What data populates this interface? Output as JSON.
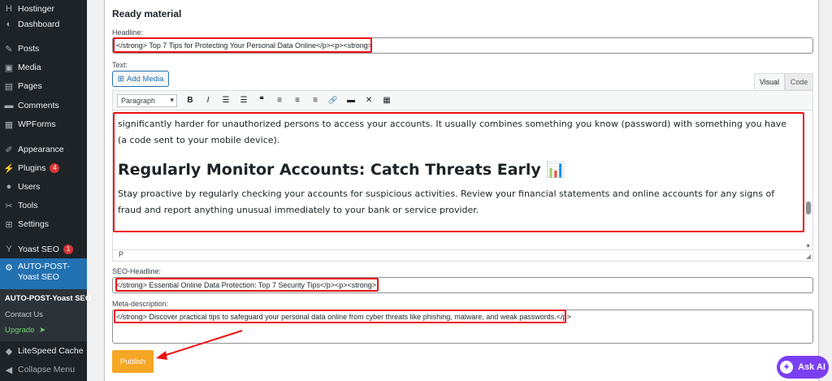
{
  "sidebar": {
    "items": [
      {
        "label": "Hostinger",
        "icon": "hostinger-icon"
      },
      {
        "label": "Dashboard",
        "icon": "dashboard-icon"
      },
      {
        "label": "Posts",
        "icon": "pin-icon"
      },
      {
        "label": "Media",
        "icon": "media-icon"
      },
      {
        "label": "Pages",
        "icon": "pages-icon"
      },
      {
        "label": "Comments",
        "icon": "comment-icon"
      },
      {
        "label": "WPForms",
        "icon": "form-icon"
      },
      {
        "label": "Appearance",
        "icon": "brush-icon"
      },
      {
        "label": "Plugins",
        "icon": "plug-icon",
        "badge": "4"
      },
      {
        "label": "Users",
        "icon": "users-icon"
      },
      {
        "label": "Tools",
        "icon": "wrench-icon"
      },
      {
        "label": "Settings",
        "icon": "settings-icon"
      },
      {
        "label": "Yoast SEO",
        "icon": "yoast-icon",
        "badge": "1"
      },
      {
        "label": "AUTO-POST-Yoast SEO",
        "icon": "gear-icon"
      },
      {
        "label": "LiteSpeed Cache",
        "icon": "litespeed-icon"
      },
      {
        "label": "Collapse Menu",
        "icon": "collapse-icon"
      }
    ],
    "submenu": {
      "title": "AUTO-POST-Yoast SEO",
      "contact": "Contact Us",
      "upgrade": "Upgrade",
      "upgrade_arrow": "➤"
    }
  },
  "main": {
    "section_title": "Ready material",
    "headline": {
      "label": "Headline:",
      "value": "</strong> Top 7 Tips for Protecting Your Personal Data Online</p><p><strong>"
    },
    "text_label": "Text:",
    "add_media": "Add Media",
    "tabs": {
      "visual": "Visual",
      "code": "Code"
    },
    "toolbar": {
      "format_select": "Paragraph",
      "buttons": [
        "B",
        "I",
        "☰",
        "☰",
        "❝",
        "≡",
        "≡",
        "≡",
        "🔗",
        "▬",
        "✕",
        "▦"
      ]
    },
    "editor_content": {
      "paragraph1": "significantly harder for unauthorized persons to access your accounts. It usually combines something you know (password) with something you have (a code sent to your mobile device).",
      "heading": "Regularly Monitor Accounts: Catch Threats Early 📊",
      "paragraph2": "Stay proactive by regularly checking your accounts for suspicious activities. Review your financial statements and online accounts for any signs of fraud and report anything unusual immediately to your bank or service provider.",
      "status_path": "P"
    },
    "seo_headline": {
      "label": "SEO-Headline:",
      "value": "</strong> Essential Online Data Protection: Top 7 Security Tips</p><p><strong>"
    },
    "meta_description": {
      "label": "Meta-description:",
      "value": "</strong> Discover practical tips to safeguard your personal data online from cyber threats like phishing, malware, and weak passwords.</p>"
    },
    "publish": "Publish"
  },
  "ask_ai": "Ask AI",
  "colors": {
    "sidebar_bg": "#1d2327",
    "active": "#2271b1",
    "publish": "#f5a623",
    "highlight": "#e11111",
    "ask_ai": "#7b3ff2"
  }
}
